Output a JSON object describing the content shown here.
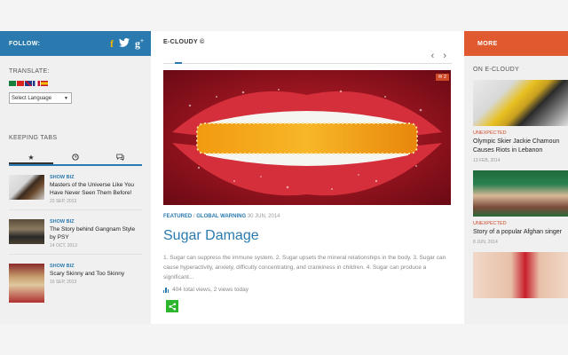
{
  "follow": {
    "label": "FOLLOW:",
    "icons": [
      "facebook-icon",
      "twitter-icon",
      "google-plus-icon"
    ]
  },
  "translate": {
    "title": "TRANSLATE:",
    "select_value": "Select Language"
  },
  "keeping": {
    "title": "KEEPING TABS",
    "tabs": [
      "star-icon",
      "clock-icon",
      "comments-icon"
    ],
    "items": [
      {
        "category": "SHOW BIZ",
        "title": "Masters of the Universe Like You Have Never Seen Them Before!",
        "date": "23 SEP, 2013"
      },
      {
        "category": "SHOW BIZ",
        "title": "The Story behind Gangnam Style by PSY",
        "date": "14 OCT, 2013"
      },
      {
        "category": "SHOW BIZ",
        "title": "Scary Skinny and Too Skinny",
        "date": "16 SEP, 2013"
      }
    ]
  },
  "main": {
    "brand": "E-CLOUDY ©",
    "comment_count": "2",
    "category": "FEATURED",
    "sep": " / ",
    "subcategory": "GLOBAL WARNING",
    "date": "30 JUN, 2014",
    "title": "Sugar Damage",
    "excerpt": "1. Sugar can suppress the immune system. 2. Sugar upsets the mineral relationships in the body. 3. Sugar can cause hyperactivity, anxiety, difficulty concentrating, and crankiness in children. 4. Sugar can produce a significant...",
    "views": "404 total views, 2 views today"
  },
  "right": {
    "more_label": "MORE",
    "section_title": "ON E-CLOUDY",
    "items": [
      {
        "category": "UNEXPECTED",
        "title": "Olympic Skier Jackie Chamoun Causes Riots in Lebanon",
        "date": "13 FEB, 2014"
      },
      {
        "category": "UNEXPECTED",
        "title": "Story of a popular Afghan singer",
        "date": "8 JUN, 2014"
      }
    ]
  },
  "colors": {
    "accent_blue": "#2a7ab0",
    "accent_orange": "#e15a2f",
    "share_green": "#2db52d"
  }
}
